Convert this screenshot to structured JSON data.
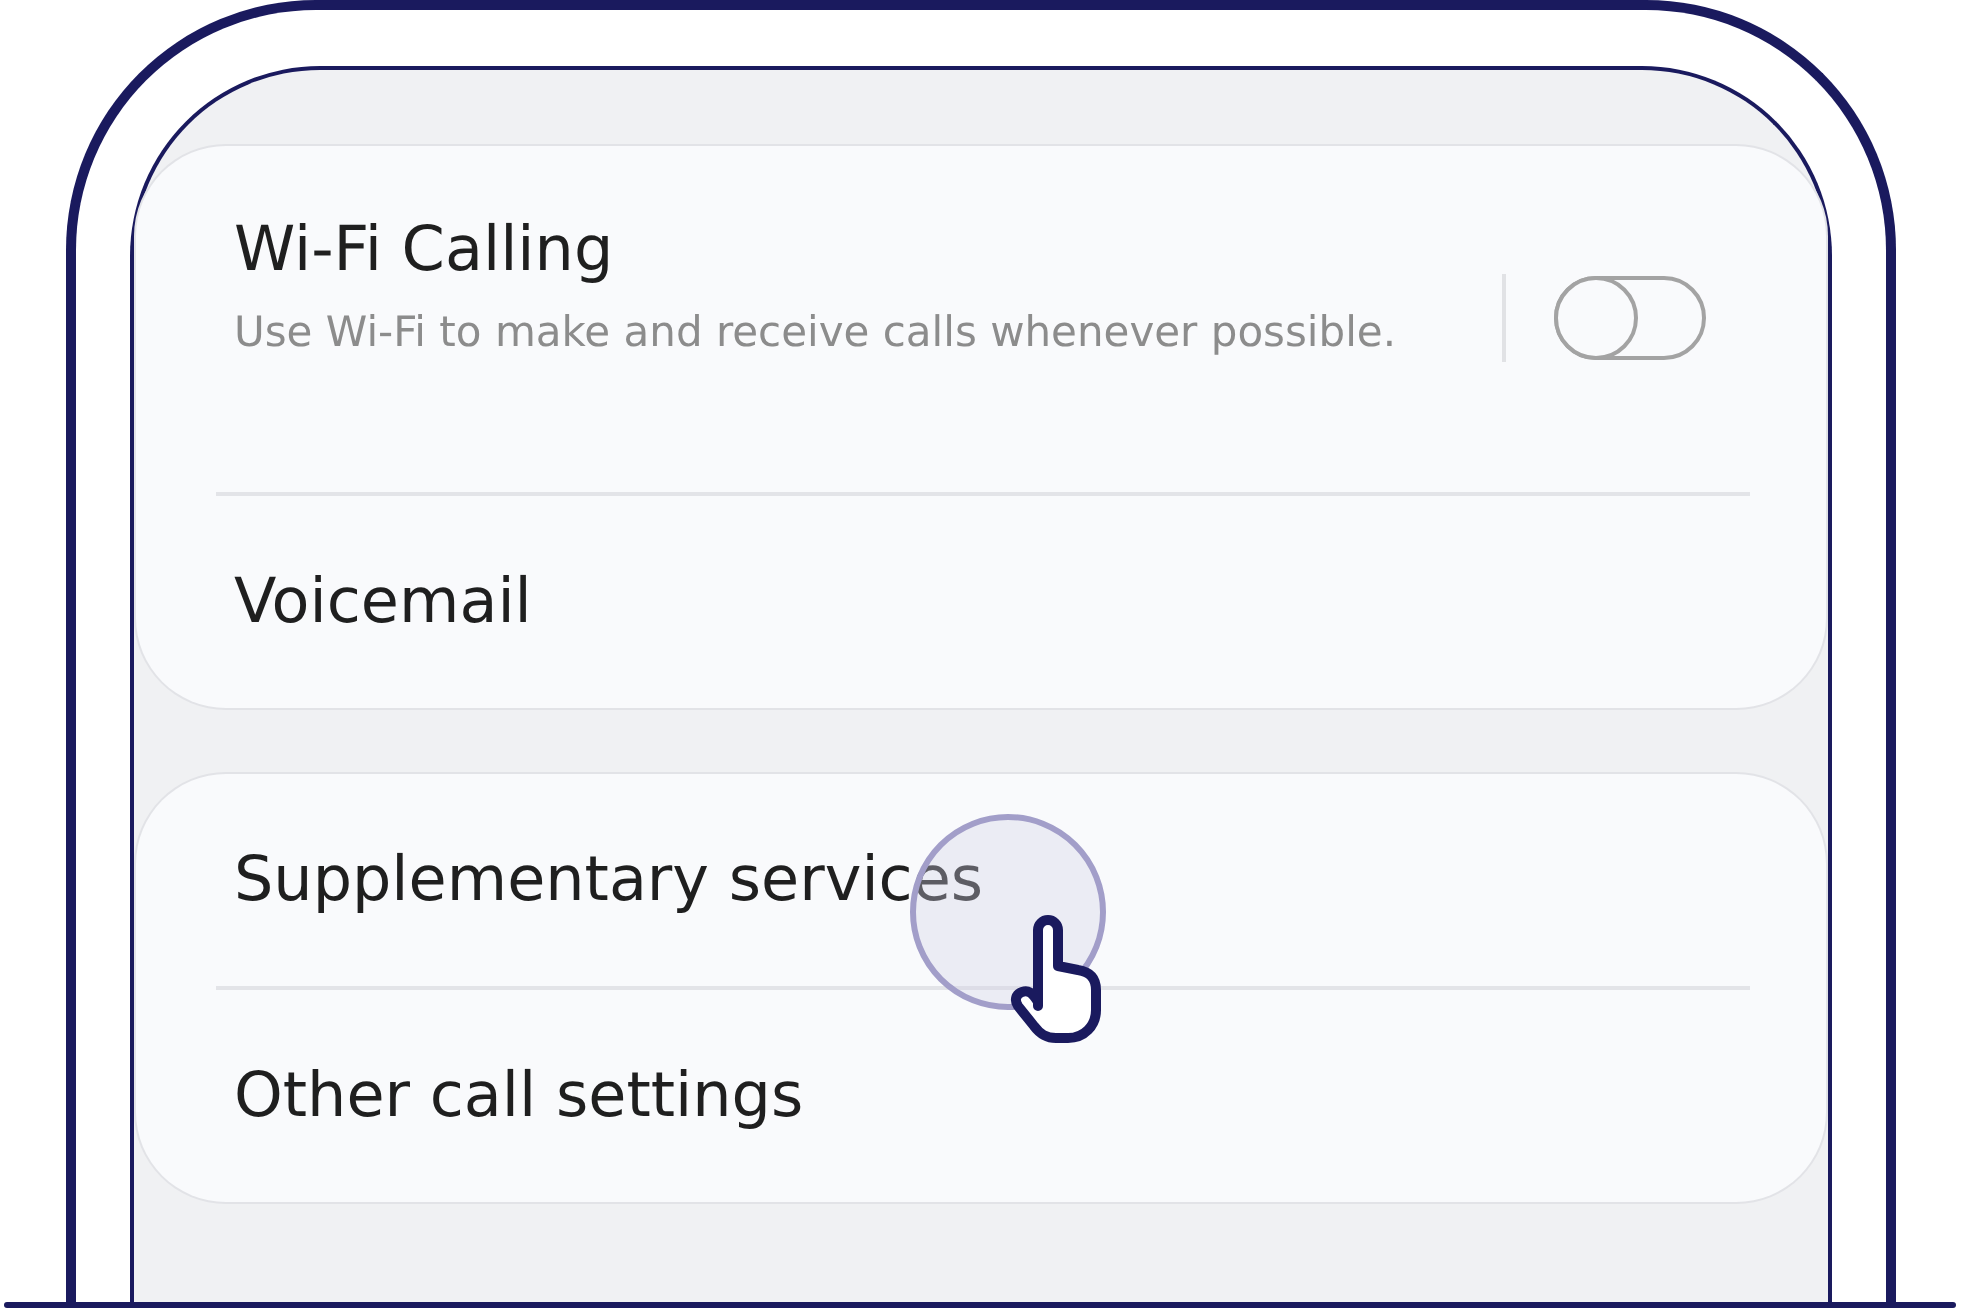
{
  "groups": [
    {
      "rows": [
        {
          "kind": "toggle",
          "title": "Wi-Fi Calling",
          "subtitle": "Use Wi-Fi to make and receive calls whenever possible.",
          "on": false
        },
        {
          "kind": "plain",
          "title": "Voicemail"
        }
      ]
    },
    {
      "rows": [
        {
          "kind": "plain",
          "title": "Supplementary services"
        },
        {
          "kind": "plain",
          "title": "Other call settings"
        }
      ]
    }
  ]
}
